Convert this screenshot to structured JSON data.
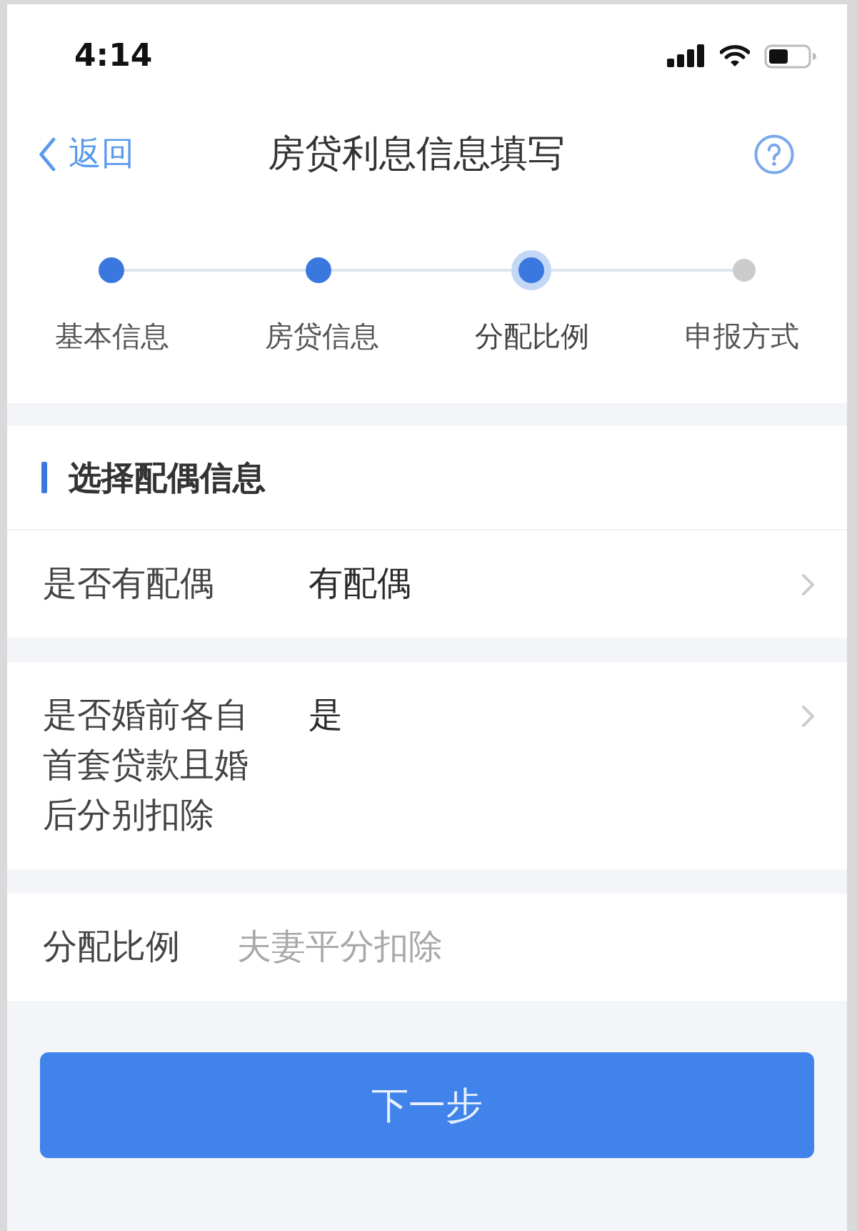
{
  "status_bar": {
    "time": "4:14"
  },
  "nav_bar": {
    "back_label": "返回",
    "title": "房贷利息信息填写"
  },
  "steps": [
    {
      "label": "基本信息",
      "completed": true,
      "selected": false
    },
    {
      "label": "房贷信息",
      "completed": true,
      "selected": false
    },
    {
      "label": "分配比例",
      "completed": false,
      "selected": true
    },
    {
      "label": "申报方式",
      "completed": false,
      "selected": false
    }
  ],
  "section": {
    "title": "选择配偶信息"
  },
  "rows": [
    {
      "kind": "select",
      "label": "是否有配偶",
      "value": "有配偶"
    },
    {
      "kind": "select",
      "label": "是否婚前各自首套贷款且婚后分别扣除",
      "value": "是"
    },
    {
      "kind": "readonly",
      "label": "分配比例",
      "value": "夫妻平分扣除"
    }
  ],
  "buttons": [
    {
      "label": "下一步"
    }
  ]
}
